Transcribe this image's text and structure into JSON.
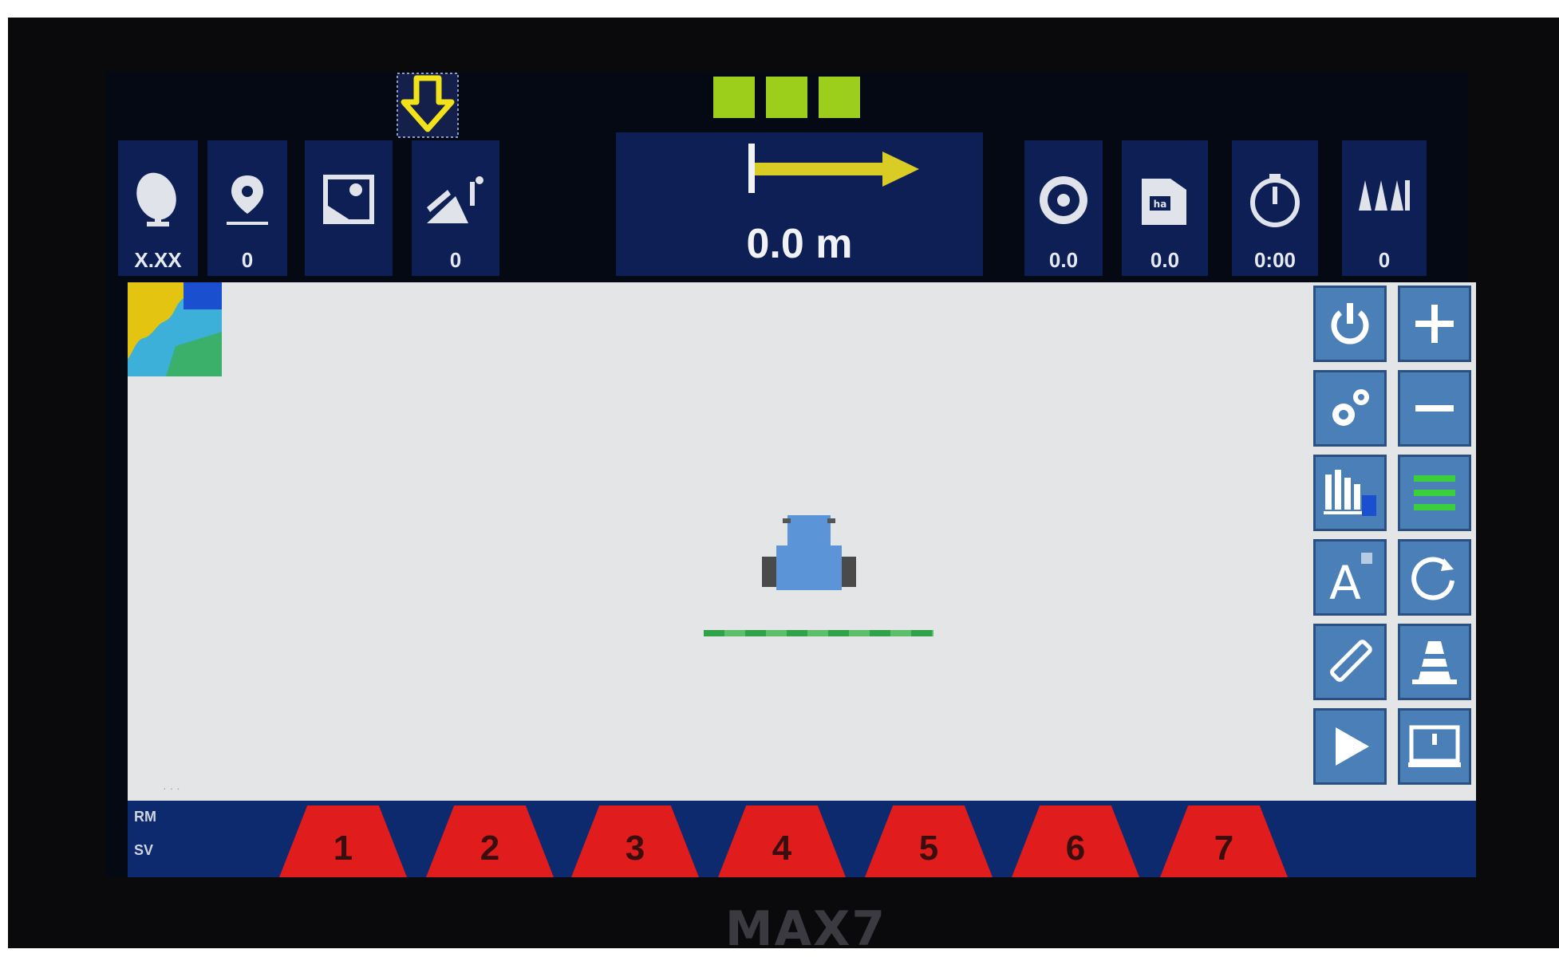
{
  "top_bar": {
    "gps_signal_bars": 3,
    "tiles": [
      {
        "icon": "satellite-dish-icon",
        "value": "X.XX"
      },
      {
        "icon": "location-pin-icon",
        "value": "0"
      },
      {
        "icon": "field-boundary-icon",
        "value": ""
      },
      {
        "icon": "applied-area-icon",
        "value": "0"
      },
      {
        "icon": "speedometer-icon",
        "value": "0.0"
      },
      {
        "icon": "area-ha-icon",
        "value": "0.0"
      },
      {
        "icon": "timer-icon",
        "value": "0:00"
      },
      {
        "icon": "sections-count-icon",
        "value": "0"
      }
    ],
    "cross_track": {
      "value": "0.0 m",
      "direction": "right"
    }
  },
  "map": {
    "scale_text": "· · ·",
    "vehicle_icon": "tractor-icon"
  },
  "side_buttons": [
    {
      "name": "power-button",
      "icon": "power-icon"
    },
    {
      "name": "zoom-in-button",
      "icon": "plus-icon"
    },
    {
      "name": "settings-button",
      "icon": "gears-icon"
    },
    {
      "name": "zoom-out-button",
      "icon": "minus-icon"
    },
    {
      "name": "section-control-button",
      "icon": "section-chart-icon"
    },
    {
      "name": "guidance-lines-button",
      "icon": "guidance-lines-icon"
    },
    {
      "name": "ab-line-button",
      "icon": "ab-line-icon"
    },
    {
      "name": "rotate-view-button",
      "icon": "rotate-icon"
    },
    {
      "name": "measure-button",
      "icon": "ruler-icon"
    },
    {
      "name": "marker-button",
      "icon": "cone-icon"
    },
    {
      "name": "play-button",
      "icon": "play-icon"
    },
    {
      "name": "screen-button",
      "icon": "monitor-icon"
    }
  ],
  "section_bar": {
    "left_labels": [
      "RM",
      "SV"
    ],
    "sections": [
      "1",
      "2",
      "3",
      "4",
      "5",
      "6",
      "7"
    ],
    "section_color": "#e01c1c"
  },
  "colors": {
    "panel": "#0d1f55",
    "map_bg": "#e4e5e6",
    "gps_green": "#9ccf1c",
    "warning_yellow": "#f2e21a",
    "button_blue": "#4a7fb8"
  },
  "device_label": "MAX7"
}
